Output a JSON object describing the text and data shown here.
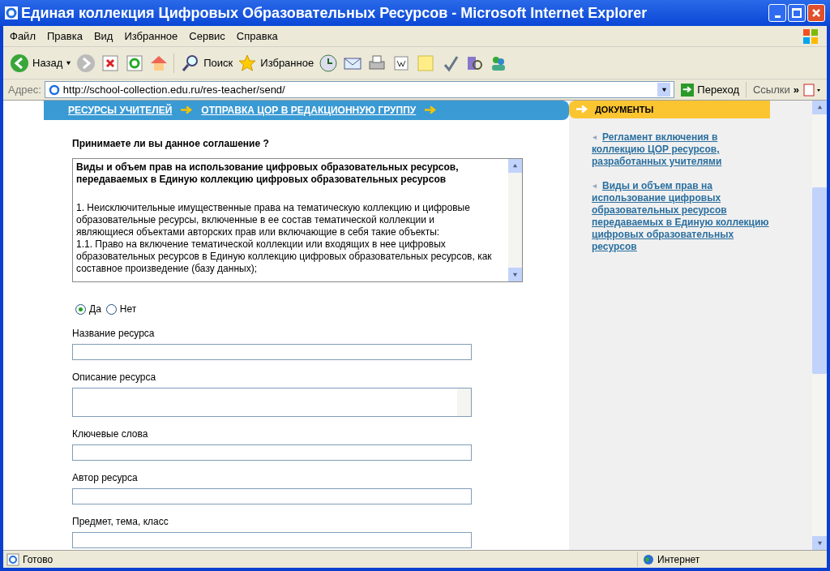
{
  "window": {
    "title": "Единая коллекция Цифровых Образовательных Ресурсов - Microsoft Internet Explorer"
  },
  "menu": [
    "Файл",
    "Правка",
    "Вид",
    "Избранное",
    "Сервис",
    "Справка"
  ],
  "toolbar": {
    "back": "Назад",
    "search": "Поиск",
    "favorites": "Избранное"
  },
  "address": {
    "label": "Адрес:",
    "value": "http://school-collection.edu.ru/res-teacher/send/",
    "go": "Переход",
    "links": "Ссылки",
    "more": "»"
  },
  "breadcrumbs": [
    "РЕСУРСЫ УЧИТЕЛЕЙ",
    "ОТПРАВКА ЦОР В РЕДАКЦИОННУЮ ГРУППУ"
  ],
  "agreement": {
    "question": "Принимаете ли вы данное соглашение ?",
    "title_lines": [
      "Виды и объем прав на использование цифровых образовательных ресурсов,",
      "передаваемых в Единую коллекцию цифровых образовательных ресурсов"
    ],
    "lines": [
      "1. Неисключительные имущественные права на тематическую коллекцию и цифровые",
      "образовательные ресурсы, включенные в ее состав тематической коллекции и",
      "являющиеся объектами авторских прав или включающие в себя такие объекты:",
      "1.1. Право на включение тематической коллекции или входящих в нее цифровых",
      "образовательных ресурсов в Единую коллекцию цифровых образовательных ресурсов, как",
      "составное произведение (базу данных);"
    ]
  },
  "options": [
    {
      "label": "Да",
      "selected": true
    },
    {
      "label": "Нет",
      "selected": false
    }
  ],
  "fields": [
    {
      "label": "Название ресурса",
      "kind": "input"
    },
    {
      "label": "Описание ресурса",
      "kind": "textarea"
    },
    {
      "label": "Ключевые слова",
      "kind": "input"
    },
    {
      "label": "Автор ресурса",
      "kind": "input"
    },
    {
      "label": "Предмет, тема, класс",
      "kind": "input"
    }
  ],
  "sidebar": {
    "title": "ДОКУМЕНТЫ",
    "links": [
      [
        "Регламент включения в",
        "коллекцию ЦОР ресурсов,",
        "разработанных учителями"
      ],
      [
        "Виды и объем прав на",
        "использование цифровых",
        "образовательных ресурсов",
        "передаваемых в Единую коллекцию",
        "цифровых образовательных",
        "ресурсов"
      ]
    ]
  },
  "status_bar": {
    "text": "Готово",
    "zone": "Интернет"
  }
}
